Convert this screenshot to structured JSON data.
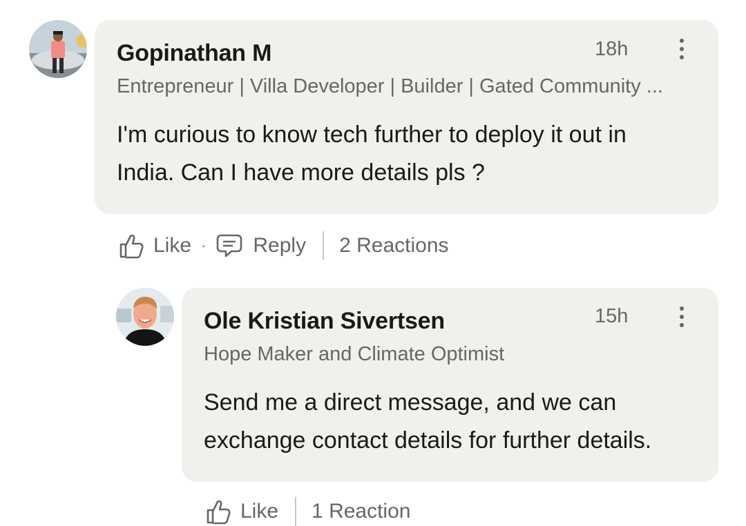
{
  "comments": [
    {
      "author": "Gopinathan M",
      "headline": "Entrepreneur | Villa Developer | Builder | Gated Community ...",
      "time": "18h",
      "text_line1": "I'm curious to know tech further to deploy it out in",
      "text_line2": "India. Can I have more details pls ?",
      "actions": {
        "like": "Like",
        "separator": "·",
        "reply": "Reply",
        "reactions": "2 Reactions"
      }
    },
    {
      "author": "Ole Kristian Sivertsen",
      "headline": "Hope Maker and Climate Optimist",
      "time": "15h",
      "text_line1": "Send me a direct message, and we can",
      "text_line2": "exchange contact details for further details.",
      "actions": {
        "like": "Like",
        "reactions": "1 Reaction"
      }
    }
  ],
  "colors": {
    "bubble": "#f2f0ed",
    "secondary_text": "#666666",
    "primary_text": "#191919"
  },
  "icons": [
    "thumbs-up-icon",
    "comment-icon",
    "more-vertical-icon"
  ]
}
